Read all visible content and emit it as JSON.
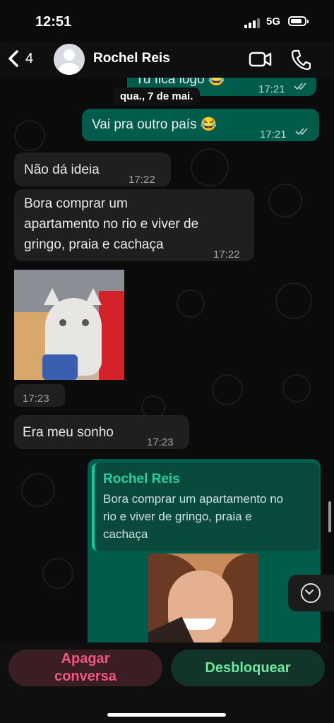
{
  "status_bar": {
    "time": "12:51",
    "network": "5G"
  },
  "header": {
    "back_count": "4",
    "contact_name": "Rochel Reis",
    "icons": [
      "chevron-left-icon",
      "avatar-icon",
      "video-call-icon",
      "phone-call-icon"
    ]
  },
  "chat": {
    "date_separator": "qua., 7 de mai.",
    "messages": [
      {
        "direction": "out",
        "text": "Tu fica logo 😂",
        "time": "17:21",
        "status": "read"
      },
      {
        "direction": "out",
        "text": "Vai pra outro país 😂",
        "time": "17:21",
        "status": "read"
      },
      {
        "direction": "in",
        "text": "Não dá ideia",
        "time": "17:22"
      },
      {
        "direction": "in",
        "text_lines": [
          "Bora comprar um",
          "apartamento no rio e viver de",
          "gringo, praia e cachaça"
        ],
        "time": "17:22"
      },
      {
        "direction": "in",
        "type": "sticker",
        "description_icon": "cat-sticker-icon",
        "time": "17:23"
      },
      {
        "direction": "in",
        "text": "Era meu sonho",
        "time": "17:23"
      }
    ],
    "reply": {
      "quoted_author": "Rochel Reis",
      "quoted_lines": [
        "Bora comprar um apartamento no",
        "rio e viver de gringo, praia e",
        "cachaça"
      ],
      "image_icon": "reply-image-icon"
    }
  },
  "footer": {
    "delete_label_line1": "Apagar",
    "delete_label_line2": "conversa",
    "unblock_label": "Desbloquear"
  },
  "colors": {
    "outgoing_bubble": "#025c4c",
    "incoming_bubble": "#1f1f1f",
    "accent_green": "#6ee7a1",
    "delete_red": "#f0577b"
  }
}
